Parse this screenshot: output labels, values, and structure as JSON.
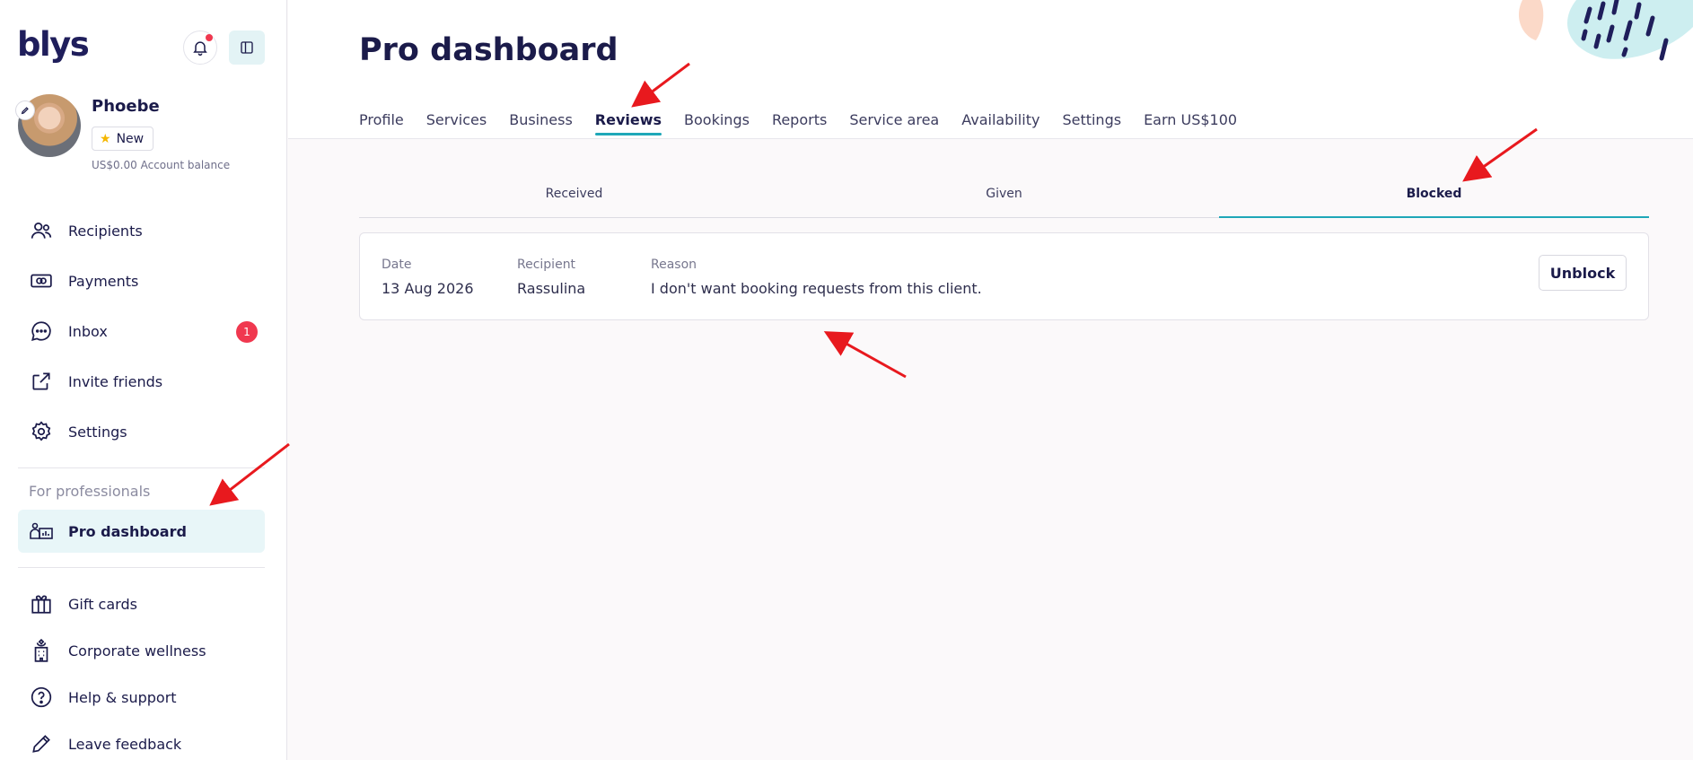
{
  "brand": {
    "logo": "blys"
  },
  "user": {
    "name": "Phoebe",
    "badge": "New",
    "balance_amount": "US$0.00",
    "balance_label": "Account balance"
  },
  "sidebar": {
    "items": [
      {
        "label": "Recipients",
        "icon": "recipients-icon"
      },
      {
        "label": "Payments",
        "icon": "payments-icon"
      },
      {
        "label": "Inbox",
        "icon": "chat-icon",
        "badge": "1"
      },
      {
        "label": "Invite friends",
        "icon": "share-icon"
      },
      {
        "label": "Settings",
        "icon": "gear-icon"
      }
    ],
    "section_label": "For professionals",
    "pro_item": {
      "label": "Pro dashboard",
      "icon": "pro-dashboard-icon"
    },
    "bottom_items": [
      {
        "label": "Gift cards",
        "icon": "gift-icon"
      },
      {
        "label": "Corporate wellness",
        "icon": "building-icon"
      },
      {
        "label": "Help & support",
        "icon": "help-icon"
      },
      {
        "label": "Leave feedback",
        "icon": "pencil-icon"
      }
    ]
  },
  "main": {
    "title": "Pro dashboard",
    "tabs": [
      "Profile",
      "Services",
      "Business",
      "Reviews",
      "Bookings",
      "Reports",
      "Service area",
      "Availability",
      "Settings",
      "Earn US$100"
    ],
    "active_tab": "Reviews",
    "subtabs": [
      "Received",
      "Given",
      "Blocked"
    ],
    "active_subtab": "Blocked",
    "blocked": {
      "date_label": "Date",
      "date_value": "13 Aug 2026",
      "recipient_label": "Recipient",
      "recipient_value": "Rassulina",
      "reason_label": "Reason",
      "reason_value": "I don't want booking requests from this client.",
      "unblock_label": "Unblock"
    }
  },
  "colors": {
    "accent": "#1ea7b8",
    "alert": "#f0384f",
    "text": "#1b1b4a",
    "annotation": "#e8191e"
  }
}
